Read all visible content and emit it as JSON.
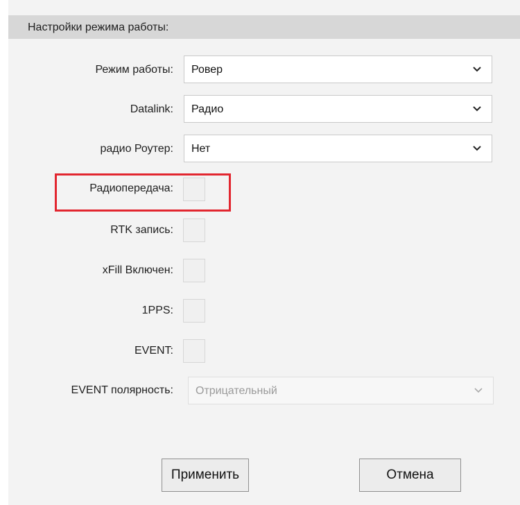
{
  "section": {
    "title": "Настройки режима работы:"
  },
  "fields": {
    "work_mode": {
      "label": "Режим работы:",
      "value": "Ровер"
    },
    "datalink": {
      "label": "Datalink:",
      "value": "Радио"
    },
    "radio_router": {
      "label": "радио Роутер:",
      "value": "Нет"
    },
    "radio_transmit": {
      "label": "Радиопередача:",
      "checked": false
    },
    "rtk_record": {
      "label": "RTK запись:",
      "checked": false
    },
    "xfill": {
      "label": "xFill Включен:",
      "checked": false
    },
    "pps": {
      "label": "1PPS:",
      "checked": false
    },
    "event": {
      "label": "EVENT:",
      "checked": false
    },
    "event_polarity": {
      "label": "EVENT полярность:",
      "value": "Отрицательный",
      "disabled": true
    }
  },
  "buttons": {
    "apply": "Применить",
    "cancel": "Отмена"
  },
  "colors": {
    "highlight": "#e2262f",
    "header_bg": "#d7d7d7",
    "panel_bg": "#f3f3f3"
  },
  "icons": {
    "dropdown": "chevron-down-icon"
  }
}
